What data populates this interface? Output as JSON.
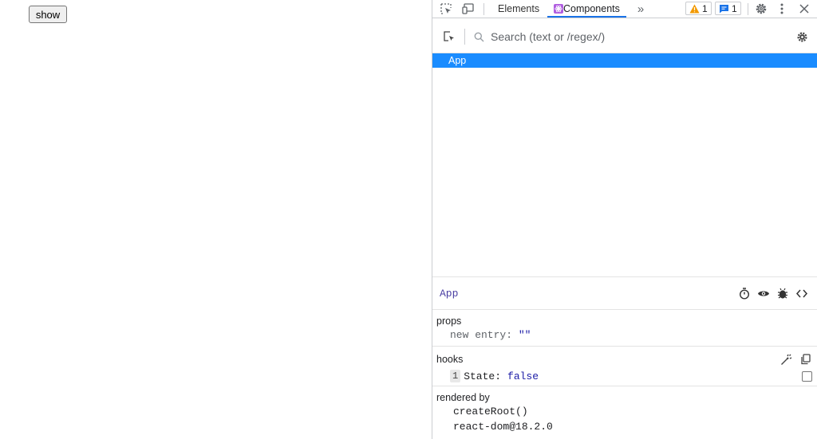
{
  "page": {
    "show_button": "show"
  },
  "devtools": {
    "tabs": [
      {
        "label": "Elements",
        "active": false
      },
      {
        "label": "Components",
        "active": true
      }
    ],
    "more_tabs": "»",
    "warnings_count": "1",
    "messages_count": "1",
    "search": {
      "placeholder": "Search (text or /regex/)",
      "value": ""
    },
    "tree": {
      "selected": "App"
    },
    "inspect": {
      "component": "App",
      "props_title": "props",
      "props": [
        {
          "key": "new entry",
          "value": "\"\""
        }
      ],
      "hooks_title": "hooks",
      "hooks": [
        {
          "index": "1",
          "name": "State",
          "value": "false"
        }
      ],
      "rendered_by_title": "rendered by",
      "rendered_by": [
        "createRoot()",
        "react-dom@18.2.0"
      ]
    },
    "colors": {
      "selected_row": "#1a8cff",
      "accent": "#1a73e8",
      "component_name": "#4b3fa3",
      "value_blue": "#1a1aa6"
    }
  }
}
